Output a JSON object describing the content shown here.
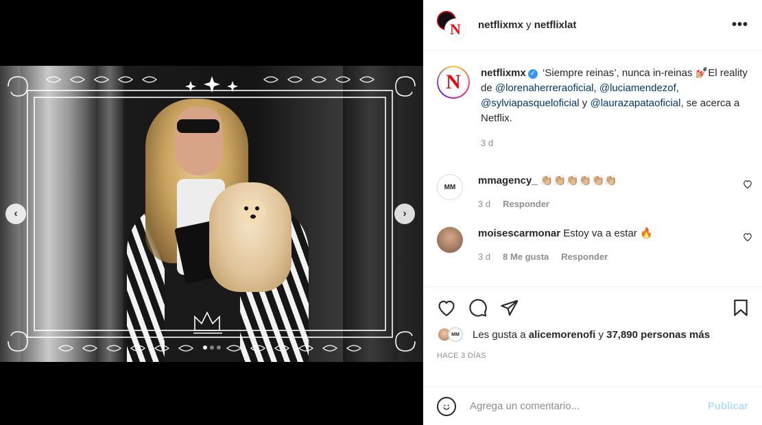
{
  "header": {
    "user1": "netflixmx",
    "joiner": "y",
    "user2": "netflixlat",
    "more_label": "•••"
  },
  "caption": {
    "username": "netflixmx",
    "text_1": "‘Siempre reinas’, nunca in-reinas 💅🏼El reality de ",
    "mention_1": "@lorenaherreraoficial",
    "sep_1": ", ",
    "mention_2": "@luciamendezof",
    "sep_2": ", ",
    "mention_3": "@sylviapasqueloficial",
    "sep_3": " y ",
    "mention_4": "@laurazapataoficial",
    "text_2": ", se acerca a Netflix.",
    "time": "3 d"
  },
  "comments": [
    {
      "username": "mmagency_",
      "text": "👏🏼👏🏼👏🏼👏🏼👏🏼👏🏼",
      "time": "3 d",
      "likes": "",
      "reply": "Responder",
      "avatar_text": "MM"
    },
    {
      "username": "moisescarmonar",
      "text": "Estoy va a estar 🔥",
      "time": "3 d",
      "likes": "8 Me gusta",
      "reply": "Responder",
      "avatar_text": ""
    }
  ],
  "likes": {
    "prefix": "Les gusta a",
    "user": "alicemorenofi",
    "middle": "y",
    "count": "37,890 personas más"
  },
  "posted": "HACE 3 DÍAS",
  "add_comment": {
    "placeholder": "Agrega un comentario...",
    "publish": "Publicar"
  },
  "carousel": {
    "prev": "‹",
    "next": "›",
    "dots": 3,
    "active_dot": 0
  },
  "colors": {
    "netflix_red": "#e50914",
    "mention": "#00376b",
    "publish_disabled": "#b2dffc"
  }
}
